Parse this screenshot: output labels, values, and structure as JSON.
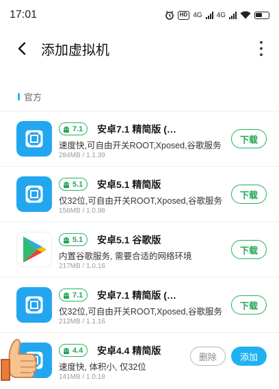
{
  "status_bar": {
    "time": "17:01",
    "hd_label": "HD",
    "net1": "4G",
    "net2": "4G"
  },
  "header": {
    "title": "添加虚拟机"
  },
  "section": {
    "label": "官方"
  },
  "apps": [
    {
      "icon": "vm-cube-icon",
      "version": "7.1",
      "name": "安卓7.1 精简版 (…",
      "desc": "速度快,可自由开关ROOT,Xposed,谷歌服务",
      "meta": "284MB / 1.1.39",
      "action": "下载"
    },
    {
      "icon": "vm-cube-icon",
      "version": "5.1",
      "name": "安卓5.1 精简版",
      "desc": "仅32位,可自由开关ROOT,Xposed,谷歌服务",
      "meta": "156MB / 1.0.98",
      "action": "下载"
    },
    {
      "icon": "google-play-icon",
      "version": "5.1",
      "name": "安卓5.1 谷歌版",
      "desc": "内置谷歌服务, 需要合适的网络环境",
      "meta": "217MB / 1.0.16",
      "action": "下载"
    },
    {
      "icon": "vm-cube-icon",
      "version": "7.1",
      "name": "安卓7.1 精简版 (…",
      "desc": "仅32位,可自由开关ROOT,Xposed,谷歌服务",
      "meta": "212MB / 1.1.16",
      "action": "下载"
    },
    {
      "icon": "vm-cube-icon",
      "version": "4.4",
      "name": "安卓4.4 精简版",
      "desc": "速度快, 体积小, 仅32位",
      "meta": "141MB / 1.0.18",
      "delete_label": "删除",
      "add_label": "添加"
    }
  ],
  "colors": {
    "accent_green": "#1fa855",
    "accent_blue": "#1fb2f0",
    "icon_blue": "#23a6f0"
  }
}
